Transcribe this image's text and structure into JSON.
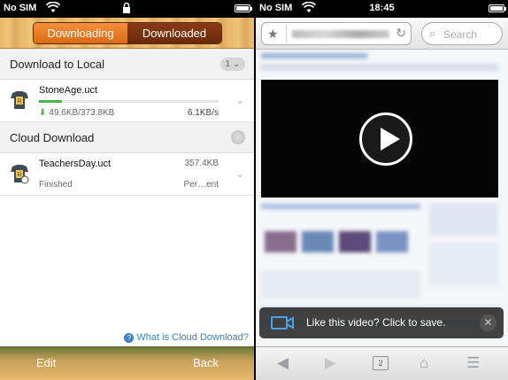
{
  "left_screen": {
    "status": {
      "carrier": "No SIM"
    },
    "segment": {
      "downloading": "Downloading",
      "downloaded": "Downloaded"
    },
    "download_local": {
      "title": "Download to Local",
      "count": "1",
      "items": [
        {
          "name": "StoneAge.uct",
          "progress_percent": 13,
          "transferred": "49.6KB/373.8KB",
          "speed": "6.1KB/s"
        }
      ]
    },
    "cloud_download": {
      "title": "Cloud Download",
      "items": [
        {
          "name": "TeachersDay.uct",
          "size": "357.4KB",
          "state": "Finished",
          "status": "Per…ent"
        }
      ]
    },
    "help_link": "What is Cloud Download?",
    "bottom": {
      "edit": "Edit",
      "back": "Back"
    }
  },
  "right_screen": {
    "status": {
      "carrier": "No SIM",
      "time": "18:45"
    },
    "search_placeholder": "Search",
    "toast": {
      "message": "Like this video? Click to save."
    },
    "tab_count": "2"
  },
  "colors": {
    "segment_active": "#e67a22",
    "segment_inactive": "#7a3210",
    "progress": "#49b54a",
    "link": "#3b82c6"
  }
}
